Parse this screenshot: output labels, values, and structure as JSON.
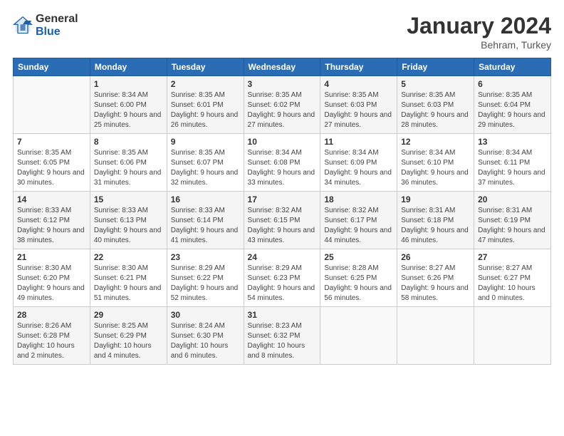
{
  "logo": {
    "general": "General",
    "blue": "Blue"
  },
  "header": {
    "title": "January 2024",
    "location": "Behram, Turkey"
  },
  "days_of_week": [
    "Sunday",
    "Monday",
    "Tuesday",
    "Wednesday",
    "Thursday",
    "Friday",
    "Saturday"
  ],
  "weeks": [
    [
      {
        "day": "",
        "sunrise": "",
        "sunset": "",
        "daylight": ""
      },
      {
        "day": "1",
        "sunrise": "Sunrise: 8:34 AM",
        "sunset": "Sunset: 6:00 PM",
        "daylight": "Daylight: 9 hours and 25 minutes."
      },
      {
        "day": "2",
        "sunrise": "Sunrise: 8:35 AM",
        "sunset": "Sunset: 6:01 PM",
        "daylight": "Daylight: 9 hours and 26 minutes."
      },
      {
        "day": "3",
        "sunrise": "Sunrise: 8:35 AM",
        "sunset": "Sunset: 6:02 PM",
        "daylight": "Daylight: 9 hours and 27 minutes."
      },
      {
        "day": "4",
        "sunrise": "Sunrise: 8:35 AM",
        "sunset": "Sunset: 6:03 PM",
        "daylight": "Daylight: 9 hours and 27 minutes."
      },
      {
        "day": "5",
        "sunrise": "Sunrise: 8:35 AM",
        "sunset": "Sunset: 6:03 PM",
        "daylight": "Daylight: 9 hours and 28 minutes."
      },
      {
        "day": "6",
        "sunrise": "Sunrise: 8:35 AM",
        "sunset": "Sunset: 6:04 PM",
        "daylight": "Daylight: 9 hours and 29 minutes."
      }
    ],
    [
      {
        "day": "7",
        "sunrise": "Sunrise: 8:35 AM",
        "sunset": "Sunset: 6:05 PM",
        "daylight": "Daylight: 9 hours and 30 minutes."
      },
      {
        "day": "8",
        "sunrise": "Sunrise: 8:35 AM",
        "sunset": "Sunset: 6:06 PM",
        "daylight": "Daylight: 9 hours and 31 minutes."
      },
      {
        "day": "9",
        "sunrise": "Sunrise: 8:35 AM",
        "sunset": "Sunset: 6:07 PM",
        "daylight": "Daylight: 9 hours and 32 minutes."
      },
      {
        "day": "10",
        "sunrise": "Sunrise: 8:34 AM",
        "sunset": "Sunset: 6:08 PM",
        "daylight": "Daylight: 9 hours and 33 minutes."
      },
      {
        "day": "11",
        "sunrise": "Sunrise: 8:34 AM",
        "sunset": "Sunset: 6:09 PM",
        "daylight": "Daylight: 9 hours and 34 minutes."
      },
      {
        "day": "12",
        "sunrise": "Sunrise: 8:34 AM",
        "sunset": "Sunset: 6:10 PM",
        "daylight": "Daylight: 9 hours and 36 minutes."
      },
      {
        "day": "13",
        "sunrise": "Sunrise: 8:34 AM",
        "sunset": "Sunset: 6:11 PM",
        "daylight": "Daylight: 9 hours and 37 minutes."
      }
    ],
    [
      {
        "day": "14",
        "sunrise": "Sunrise: 8:33 AM",
        "sunset": "Sunset: 6:12 PM",
        "daylight": "Daylight: 9 hours and 38 minutes."
      },
      {
        "day": "15",
        "sunrise": "Sunrise: 8:33 AM",
        "sunset": "Sunset: 6:13 PM",
        "daylight": "Daylight: 9 hours and 40 minutes."
      },
      {
        "day": "16",
        "sunrise": "Sunrise: 8:33 AM",
        "sunset": "Sunset: 6:14 PM",
        "daylight": "Daylight: 9 hours and 41 minutes."
      },
      {
        "day": "17",
        "sunrise": "Sunrise: 8:32 AM",
        "sunset": "Sunset: 6:15 PM",
        "daylight": "Daylight: 9 hours and 43 minutes."
      },
      {
        "day": "18",
        "sunrise": "Sunrise: 8:32 AM",
        "sunset": "Sunset: 6:17 PM",
        "daylight": "Daylight: 9 hours and 44 minutes."
      },
      {
        "day": "19",
        "sunrise": "Sunrise: 8:31 AM",
        "sunset": "Sunset: 6:18 PM",
        "daylight": "Daylight: 9 hours and 46 minutes."
      },
      {
        "day": "20",
        "sunrise": "Sunrise: 8:31 AM",
        "sunset": "Sunset: 6:19 PM",
        "daylight": "Daylight: 9 hours and 47 minutes."
      }
    ],
    [
      {
        "day": "21",
        "sunrise": "Sunrise: 8:30 AM",
        "sunset": "Sunset: 6:20 PM",
        "daylight": "Daylight: 9 hours and 49 minutes."
      },
      {
        "day": "22",
        "sunrise": "Sunrise: 8:30 AM",
        "sunset": "Sunset: 6:21 PM",
        "daylight": "Daylight: 9 hours and 51 minutes."
      },
      {
        "day": "23",
        "sunrise": "Sunrise: 8:29 AM",
        "sunset": "Sunset: 6:22 PM",
        "daylight": "Daylight: 9 hours and 52 minutes."
      },
      {
        "day": "24",
        "sunrise": "Sunrise: 8:29 AM",
        "sunset": "Sunset: 6:23 PM",
        "daylight": "Daylight: 9 hours and 54 minutes."
      },
      {
        "day": "25",
        "sunrise": "Sunrise: 8:28 AM",
        "sunset": "Sunset: 6:25 PM",
        "daylight": "Daylight: 9 hours and 56 minutes."
      },
      {
        "day": "26",
        "sunrise": "Sunrise: 8:27 AM",
        "sunset": "Sunset: 6:26 PM",
        "daylight": "Daylight: 9 hours and 58 minutes."
      },
      {
        "day": "27",
        "sunrise": "Sunrise: 8:27 AM",
        "sunset": "Sunset: 6:27 PM",
        "daylight": "Daylight: 10 hours and 0 minutes."
      }
    ],
    [
      {
        "day": "28",
        "sunrise": "Sunrise: 8:26 AM",
        "sunset": "Sunset: 6:28 PM",
        "daylight": "Daylight: 10 hours and 2 minutes."
      },
      {
        "day": "29",
        "sunrise": "Sunrise: 8:25 AM",
        "sunset": "Sunset: 6:29 PM",
        "daylight": "Daylight: 10 hours and 4 minutes."
      },
      {
        "day": "30",
        "sunrise": "Sunrise: 8:24 AM",
        "sunset": "Sunset: 6:30 PM",
        "daylight": "Daylight: 10 hours and 6 minutes."
      },
      {
        "day": "31",
        "sunrise": "Sunrise: 8:23 AM",
        "sunset": "Sunset: 6:32 PM",
        "daylight": "Daylight: 10 hours and 8 minutes."
      },
      {
        "day": "",
        "sunrise": "",
        "sunset": "",
        "daylight": ""
      },
      {
        "day": "",
        "sunrise": "",
        "sunset": "",
        "daylight": ""
      },
      {
        "day": "",
        "sunrise": "",
        "sunset": "",
        "daylight": ""
      }
    ]
  ]
}
